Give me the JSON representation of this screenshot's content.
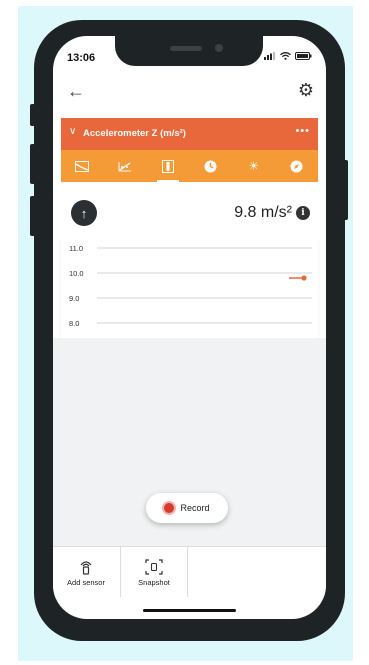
{
  "status_bar": {
    "time": "13:06"
  },
  "nav": {
    "back_icon": "back-arrow-icon",
    "settings_icon": "gear-icon"
  },
  "header": {
    "title": "Accelerometer Z (m/s²)",
    "more": "•••"
  },
  "tabs": [
    {
      "icon": "line-graph-icon",
      "active": false
    },
    {
      "icon": "scatter-graph-icon",
      "active": false
    },
    {
      "icon": "meter-icon",
      "active": true
    },
    {
      "icon": "clock-icon",
      "active": false
    },
    {
      "icon": "brightness-icon",
      "active": false
    },
    {
      "icon": "compass-icon",
      "active": false
    }
  ],
  "reading": {
    "value": "9.8 m/s²"
  },
  "graph": {
    "ticks": [
      "11.0",
      "10.0",
      "9.0",
      "8.0"
    ],
    "series_color": "#e8673b",
    "last_value": 9.8
  },
  "record": {
    "label": "Record"
  },
  "bottom_bar": {
    "items": [
      {
        "label": "Add sensor",
        "icon": "add-sensor-icon"
      },
      {
        "label": "Snapshot",
        "icon": "snapshot-icon"
      }
    ]
  },
  "colors": {
    "header": "#e8673b",
    "tabs": "#f49a37",
    "backdrop": "#dcf8fb"
  }
}
